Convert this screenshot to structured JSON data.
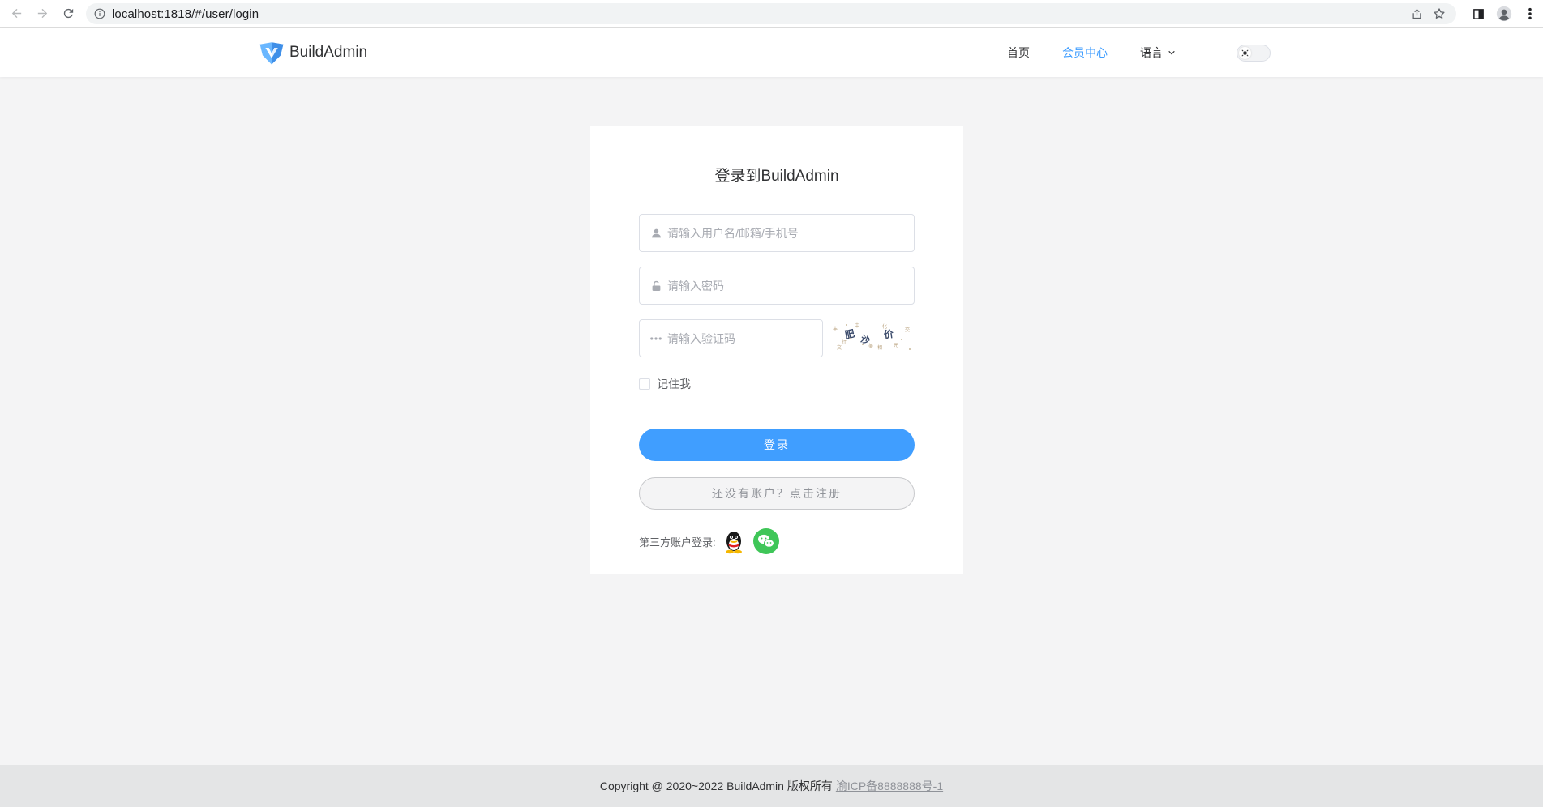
{
  "browser": {
    "url": "localhost:1818/#/user/login"
  },
  "header": {
    "brand": "BuildAdmin",
    "menu": {
      "home": "首页",
      "member_center": "会员中心",
      "language": "语言"
    }
  },
  "login": {
    "title": "登录到BuildAdmin",
    "username_placeholder": "请输入用户名/邮箱/手机号",
    "password_placeholder": "请输入密码",
    "captcha_placeholder": "请输入验证码",
    "remember_me": "记住我",
    "login_button": "登录",
    "register_button": "还没有账户？点击注册",
    "third_party_label": "第三方账户登录:"
  },
  "footer": {
    "copyright": "Copyright @ 2020~2022 BuildAdmin 版权所有",
    "icp": "渝ICP备8888888号-1"
  },
  "colors": {
    "accent": "#409eff",
    "background": "#f4f4f5",
    "wechat": "#3fc658"
  }
}
